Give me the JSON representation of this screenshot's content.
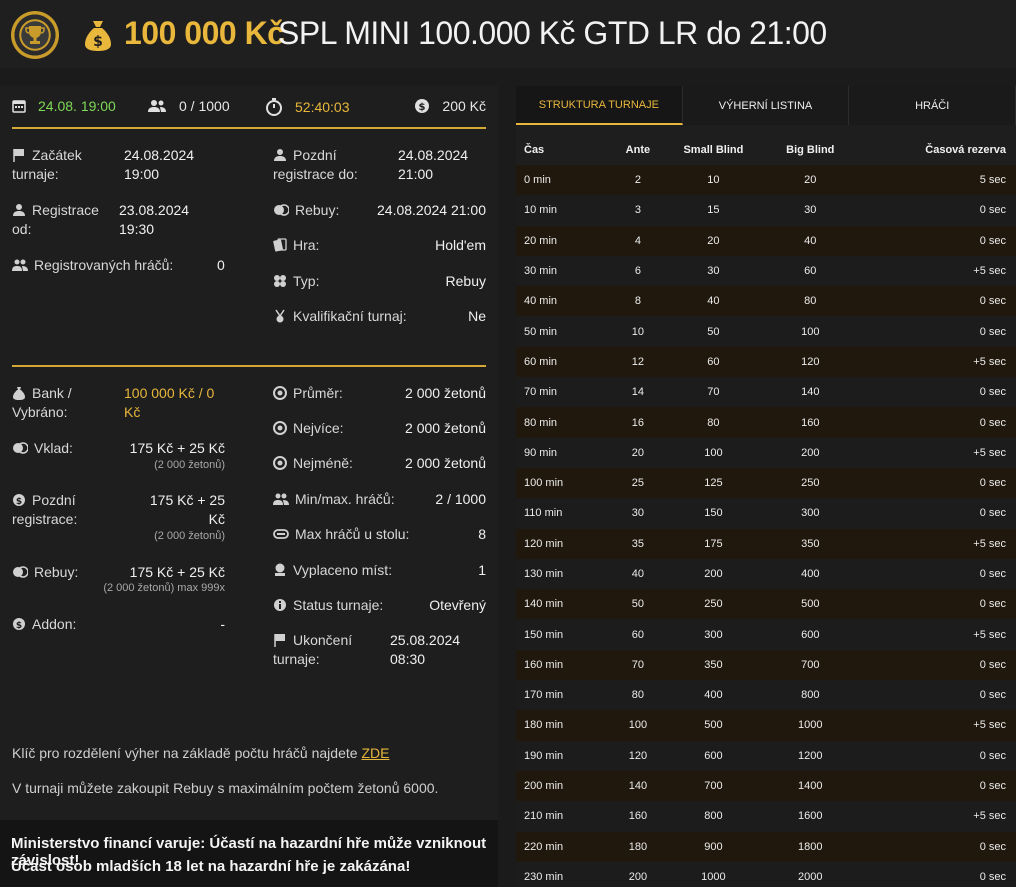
{
  "header": {
    "prize": "100 000 Kč",
    "name": "SPL MINI 100.000 Kč GTD LR do 21:00"
  },
  "summary": {
    "date": "24.08. 19:00",
    "players": "0 / 1000",
    "countdown": "52:40:03",
    "buyin": "200 Kč"
  },
  "info": {
    "start_label": "Začátek turnaje:",
    "start_value": "24.08.2024 19:00",
    "reg_from_label": "Registrace od:",
    "reg_from_value": "23.08.2024 19:30",
    "registered_label": "Registrovaných hráčů:",
    "registered_value": "0",
    "late_reg_label": "Pozdní registrace do:",
    "late_reg_value": "24.08.2024 21:00",
    "rebuy_label": "Rebuy:",
    "rebuy_value": "24.08.2024 21:00",
    "game_label": "Hra:",
    "game_value": "Hold'em",
    "type_label": "Typ:",
    "type_value": "Rebuy",
    "qual_label": "Kvalifikační turnaj:",
    "qual_value": "Ne"
  },
  "money": {
    "bank_label": "Bank / Vybráno:",
    "bank_value": "100 000 Kč / 0 Kč",
    "deposit_label": "Vklad:",
    "deposit_value": "175 Kč + 25 Kč",
    "deposit_sub": "(2 000 žetonů)",
    "late_label": "Pozdní registrace:",
    "late_value": "175 Kč + 25 Kč",
    "late_sub": "(2 000 žetonů)",
    "rebuy_label": "Rebuy:",
    "rebuy_value": "175 Kč + 25 Kč",
    "rebuy_sub": "(2 000 žetonů) max 999x",
    "addon_label": "Addon:",
    "addon_value": "-",
    "avg_label": "Průměr:",
    "avg_value": "2 000 žetonů",
    "most_label": "Nejvíce:",
    "most_value": "2 000 žetonů",
    "least_label": "Nejméně:",
    "least_value": "2 000 žetonů",
    "minmax_label": "Min/max. hráčů:",
    "minmax_value": "2 / 1000",
    "table_label": "Max hráčů u stolu:",
    "table_value": "8",
    "paid_label": "Vyplaceno míst:",
    "paid_value": "1",
    "status_label": "Status turnaje:",
    "status_value": "Otevřený",
    "end_label": "Ukončení turnaje:",
    "end_value": "25.08.2024 08:30"
  },
  "footer": {
    "key_text": "Klíč pro rozdělení výher na základě počtu hráčů najdete ",
    "key_link": "ZDE",
    "rebuy_note": "V turnaji můžete zakoupit Rebuy s maximálním počtem žetonů 6000."
  },
  "warning": {
    "line1": "Ministerstvo financí varuje: Účastí na hazardní hře může vzniknout závislost!",
    "line2": "Účast osob mladších 18 let na hazardní hře je zakázána!"
  },
  "tabs": [
    "STRUKTURA TURNAJE",
    "VÝHERNÍ LISTINA",
    "HRÁČI"
  ],
  "structure": {
    "headers": [
      "Čas",
      "Ante",
      "Small Blind",
      "Big Blind",
      "Časová rezerva"
    ],
    "rows": [
      [
        "0 min",
        "2",
        "10",
        "20",
        "5 sec"
      ],
      [
        "10 min",
        "3",
        "15",
        "30",
        "0 sec"
      ],
      [
        "20 min",
        "4",
        "20",
        "40",
        "0 sec"
      ],
      [
        "30 min",
        "6",
        "30",
        "60",
        "+5 sec"
      ],
      [
        "40 min",
        "8",
        "40",
        "80",
        "0 sec"
      ],
      [
        "50 min",
        "10",
        "50",
        "100",
        "0 sec"
      ],
      [
        "60 min",
        "12",
        "60",
        "120",
        "+5 sec"
      ],
      [
        "70 min",
        "14",
        "70",
        "140",
        "0 sec"
      ],
      [
        "80 min",
        "16",
        "80",
        "160",
        "0 sec"
      ],
      [
        "90 min",
        "20",
        "100",
        "200",
        "+5 sec"
      ],
      [
        "100 min",
        "25",
        "125",
        "250",
        "0 sec"
      ],
      [
        "110 min",
        "30",
        "150",
        "300",
        "0 sec"
      ],
      [
        "120 min",
        "35",
        "175",
        "350",
        "+5 sec"
      ],
      [
        "130 min",
        "40",
        "200",
        "400",
        "0 sec"
      ],
      [
        "140 min",
        "50",
        "250",
        "500",
        "0 sec"
      ],
      [
        "150 min",
        "60",
        "300",
        "600",
        "+5 sec"
      ],
      [
        "160 min",
        "70",
        "350",
        "700",
        "0 sec"
      ],
      [
        "170 min",
        "80",
        "400",
        "800",
        "0 sec"
      ],
      [
        "180 min",
        "100",
        "500",
        "1000",
        "+5 sec"
      ],
      [
        "190 min",
        "120",
        "600",
        "1200",
        "0 sec"
      ],
      [
        "200 min",
        "140",
        "700",
        "1400",
        "0 sec"
      ],
      [
        "210 min",
        "160",
        "800",
        "1600",
        "+5 sec"
      ],
      [
        "220 min",
        "180",
        "900",
        "1800",
        "0 sec"
      ],
      [
        "230 min",
        "200",
        "1000",
        "2000",
        "0 sec"
      ]
    ]
  },
  "colors": {
    "accent": "#e8b73c",
    "green": "#7ed957"
  }
}
